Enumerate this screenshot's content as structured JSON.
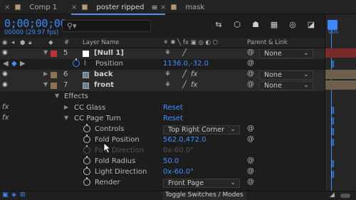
{
  "tabs": [
    {
      "label": "Comp 1",
      "active": false
    },
    {
      "label": "poster ripped",
      "active": true
    },
    {
      "label": "mask",
      "active": false
    }
  ],
  "timecode": "0;00;00;00",
  "fps": "00000 (29.97 fps)",
  "search": {
    "placeholder": ""
  },
  "columns": {
    "hash": "#",
    "layer_name": "Layer Name",
    "parent_link": "Parent & Link"
  },
  "layers": [
    {
      "num": "5",
      "name": "[Null 1]",
      "color": "#b83535",
      "parent": "None"
    },
    {
      "num": "6",
      "name": "back",
      "color": "#8c7355",
      "parent": "None"
    },
    {
      "num": "7",
      "name": "front",
      "color": "#8c7355",
      "parent": "None"
    }
  ],
  "position_prop": {
    "label": "Position",
    "value": "1136.0,-32.0"
  },
  "effects_label": "Effects",
  "cc_glass": {
    "label": "CC Glass",
    "reset": "Reset"
  },
  "cc_page_turn": {
    "label": "CC Page Turn",
    "reset": "Reset"
  },
  "props": {
    "controls": {
      "label": "Controls",
      "value": "Top Right Corner"
    },
    "fold_position": {
      "label": "Fold Position",
      "value": "562.0,472.0"
    },
    "fold_direction": {
      "label": "Fold Direction",
      "value": "0x-60.0°"
    },
    "fold_radius": {
      "label": "Fold Radius",
      "value": "50.0"
    },
    "light_direction": {
      "label": "Light Direction",
      "value": "0x-60.0°"
    },
    "render": {
      "label": "Render",
      "value": "Front Page"
    }
  },
  "timeline": {
    "ruler_label": "00s"
  },
  "bottom": {
    "toggle_label": "Toggle Switches / Modes"
  },
  "colors": {
    "accent": "#3d88ff",
    "null_label": "#b83535",
    "footage_label": "#8c7355"
  }
}
